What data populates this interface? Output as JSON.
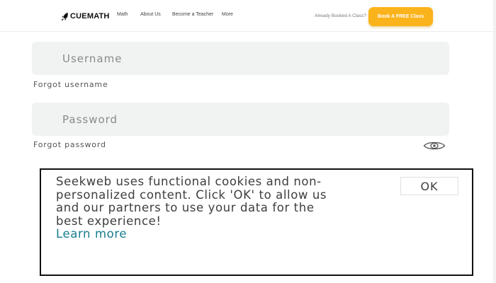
{
  "header": {
    "logo_icon": "rocket-icon",
    "logo_text": "CUEMATH",
    "nav_links": {
      "math": "Math",
      "about": "About Us",
      "teacher": "Become a Teacher",
      "more": "More"
    },
    "booked_link": "Already Booked A Class?",
    "book_button": "Book A FREE Class",
    "accent_color": "#fbb31c"
  },
  "login": {
    "username_placeholder": "Username",
    "forgot_username": "Forgot username",
    "password_placeholder": "Password",
    "forgot_password": "Forgot password",
    "show_password_icon": "eye-icon"
  },
  "cookie_banner": {
    "message": "Seekweb uses functional cookies and non-personalized content. Click 'OK' to allow us and our partners to use your data for the best experience!",
    "learn_more": "Learn more",
    "ok_button": "OK",
    "link_color": "#167d8c"
  }
}
